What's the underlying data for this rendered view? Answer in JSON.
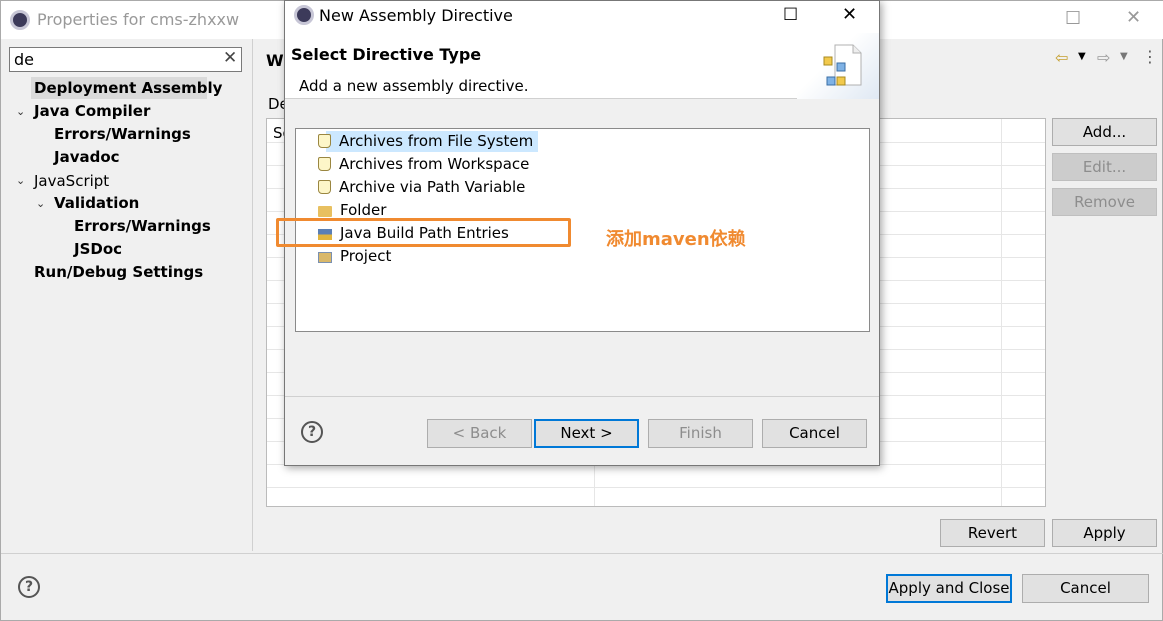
{
  "props_window": {
    "title": "Properties for cms-zhxxw",
    "filter_value": "de",
    "tree": [
      {
        "label": "Deployment Assembly",
        "level": 0,
        "expanded": null,
        "selected": true
      },
      {
        "label": "Java Compiler",
        "level": 0,
        "expanded": true
      },
      {
        "label": "Errors/Warnings",
        "level": 1
      },
      {
        "label": "Javadoc",
        "level": 1
      },
      {
        "label": "JavaScript",
        "level": 0,
        "expanded": true
      },
      {
        "label": "Validation",
        "level": 1,
        "expanded": true
      },
      {
        "label": "Errors/Warnings",
        "level": 2
      },
      {
        "label": "JSDoc",
        "level": 2
      },
      {
        "label": "Run/Debug Settings",
        "level": 0
      }
    ],
    "page_head_partial": "W",
    "page_label_partial": "De",
    "table_cell_partial": "So",
    "side_buttons": {
      "add": "Add...",
      "edit": "Edit...",
      "remove": "Remove"
    },
    "revert": "Revert",
    "apply": "Apply",
    "apply_close": "Apply and Close",
    "cancel": "Cancel",
    "help_glyph": "?"
  },
  "dialog": {
    "title": "New Assembly Directive",
    "header_title": "Select Directive Type",
    "header_desc": "Add a new assembly directive.",
    "items": [
      {
        "label": "Archives from File System",
        "icon": "jar-icon",
        "selected": true
      },
      {
        "label": "Archives from Workspace",
        "icon": "jar-icon"
      },
      {
        "label": "Archive via Path Variable",
        "icon": "jar-icon"
      },
      {
        "label": "Folder",
        "icon": "folder-icon"
      },
      {
        "label": "Java Build Path Entries",
        "icon": "java-build-path-icon"
      },
      {
        "label": "Project",
        "icon": "project-icon"
      }
    ],
    "annotation": "添加maven依赖",
    "buttons": {
      "back": "< Back",
      "next": "Next >",
      "finish": "Finish",
      "cancel": "Cancel"
    },
    "help_glyph": "?"
  },
  "colors": {
    "annotation": "#f08a30",
    "selection": "#cce8ff",
    "default_button_border": "#0078d7"
  }
}
